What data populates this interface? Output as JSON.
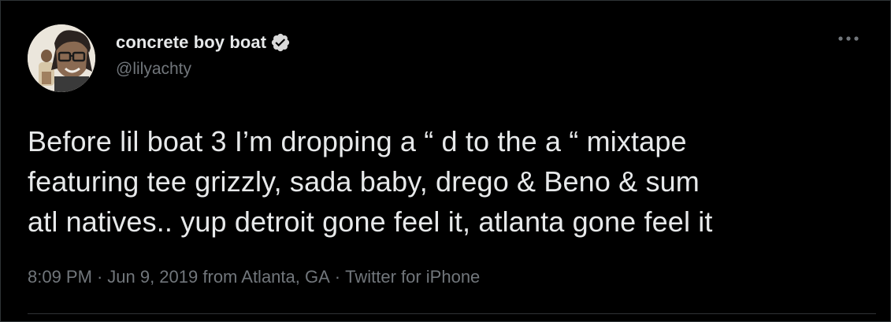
{
  "author": {
    "display_name": "concrete boy boat",
    "handle": "@lilyachty",
    "verified": true
  },
  "tweet": {
    "text": "Before lil boat 3 I’m dropping a “ d to the a “ mixtape\nfeaturing tee grizzly, sada baby, drego & Beno & sum\natl natives..  yup detroit gone feel it, atlanta gone feel it",
    "time": "8:09 PM",
    "date": "Jun 9, 2019",
    "location": "from Atlanta, GA",
    "source": "Twitter for iPhone",
    "separator": "·"
  },
  "icons": {
    "more": "more-horizontal-icon",
    "verified": "verified-badge-icon"
  },
  "colors": {
    "background": "#000000",
    "text_primary": "#e7e9ea",
    "text_secondary": "#71767b",
    "divider": "#2f3336"
  }
}
